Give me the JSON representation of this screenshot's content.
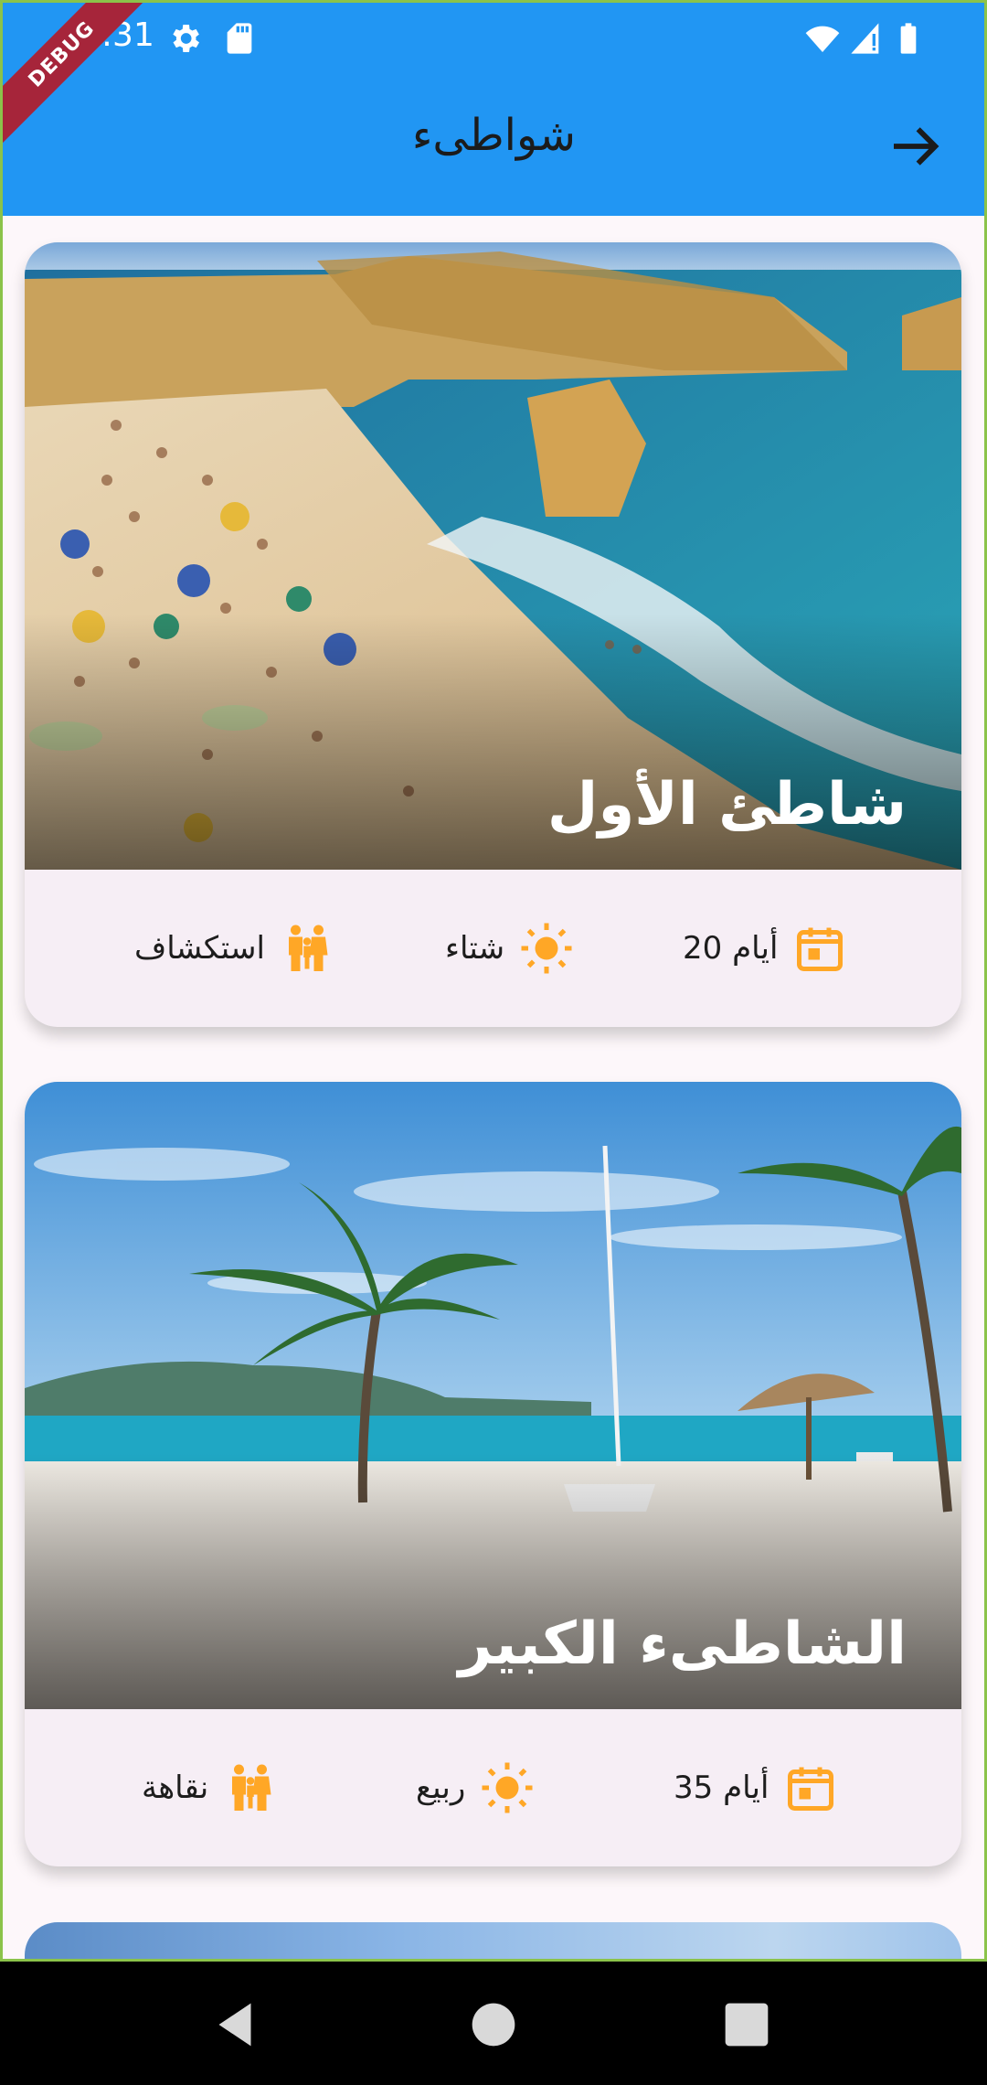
{
  "status_bar": {
    "time": "3:31",
    "debug_label": "DEBUG"
  },
  "app_bar": {
    "title": "شواطىء",
    "back_icon": "arrow-right-icon"
  },
  "colors": {
    "primary": "#2196f3",
    "accent": "#ffa726",
    "card_bg": "#f6eef5"
  },
  "cards": [
    {
      "title": "شاطئ الأول",
      "duration": "20 أيام",
      "season": "شتاء",
      "category": "استكشاف"
    },
    {
      "title": "الشاطىء الكبير",
      "duration": "35 أيام",
      "season": "ربيع",
      "category": "نقاهة"
    }
  ]
}
